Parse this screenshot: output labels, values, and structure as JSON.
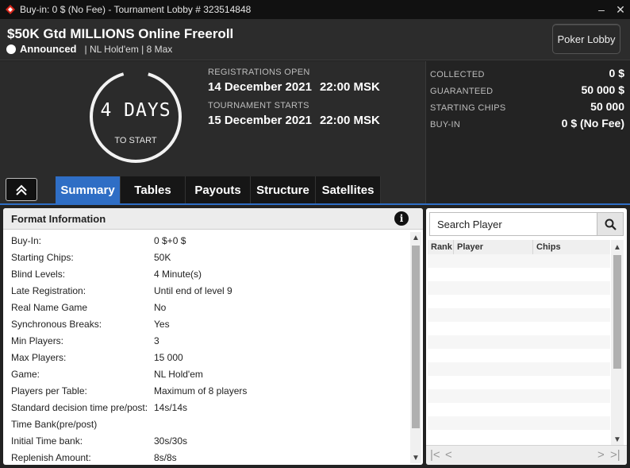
{
  "window": {
    "title": "Buy-in: 0 $ (No Fee) - Tournament Lobby # 323514848",
    "minimize_glyph": "–",
    "close_glyph": "✕"
  },
  "header": {
    "tournament_name": "$50K Gtd MILLIONS Online Freeroll",
    "status": "Announced",
    "game_info": "| NL Hold'em | 8 Max",
    "lobby_button": "Poker Lobby"
  },
  "countdown": {
    "value": "4 DAYS",
    "caption": "TO START"
  },
  "schedule": {
    "registration_label": "REGISTRATIONS OPEN",
    "registration_date": "14 December 2021",
    "registration_time": "22:00 MSK",
    "start_label": "TOURNAMENT STARTS",
    "start_date": "15 December 2021",
    "start_time": "22:00 MSK"
  },
  "stats": {
    "collected_label": "COLLECTED",
    "collected_value": "0 $",
    "guaranteed_label": "GUARANTEED",
    "guaranteed_value": "50 000 $",
    "chips_label": "STARTING CHIPS",
    "chips_value": "50 000",
    "buyin_label": "BUY-IN",
    "buyin_value": "0 $ (No Fee)"
  },
  "tabs": [
    {
      "label": "Summary",
      "active": true
    },
    {
      "label": "Tables",
      "active": false
    },
    {
      "label": "Payouts",
      "active": false
    },
    {
      "label": "Structure",
      "active": false
    },
    {
      "label": "Satellites",
      "active": false
    }
  ],
  "format": {
    "title": "Format Information",
    "info_glyph": "i",
    "rows": [
      {
        "key": "Buy-In:",
        "value": "0 $+0 $"
      },
      {
        "key": "Starting Chips:",
        "value": "50K"
      },
      {
        "key": "Blind Levels:",
        "value": "4 Minute(s)"
      },
      {
        "key": "Late Registration:",
        "value": "Until end of level 9"
      },
      {
        "key": "Real Name Game",
        "value": "No"
      },
      {
        "key": "Synchronous Breaks:",
        "value": "Yes"
      },
      {
        "key": "Min Players:",
        "value": "3"
      },
      {
        "key": "Max Players:",
        "value": "15 000"
      },
      {
        "key": "Game:",
        "value": "NL Hold'em"
      },
      {
        "key": "Players per Table:",
        "value": "Maximum of 8 players"
      },
      {
        "key": "Standard decision time pre/post:",
        "value": "14s/14s"
      },
      {
        "key": "Time Bank(pre/post)",
        "value": ""
      },
      {
        "key": "Initial Time bank:",
        "value": "30s/30s"
      },
      {
        "key": "Replenish Amount:",
        "value": "8s/8s"
      }
    ]
  },
  "players": {
    "search_placeholder": "Search Player",
    "columns": [
      "Rank",
      "Player",
      "Chips"
    ],
    "rows": []
  },
  "pager": {
    "first": "|<",
    "prev": "<",
    "next": ">",
    "last": ">|"
  },
  "colors": {
    "accent": "#2f6ec5",
    "background": "#222222"
  }
}
